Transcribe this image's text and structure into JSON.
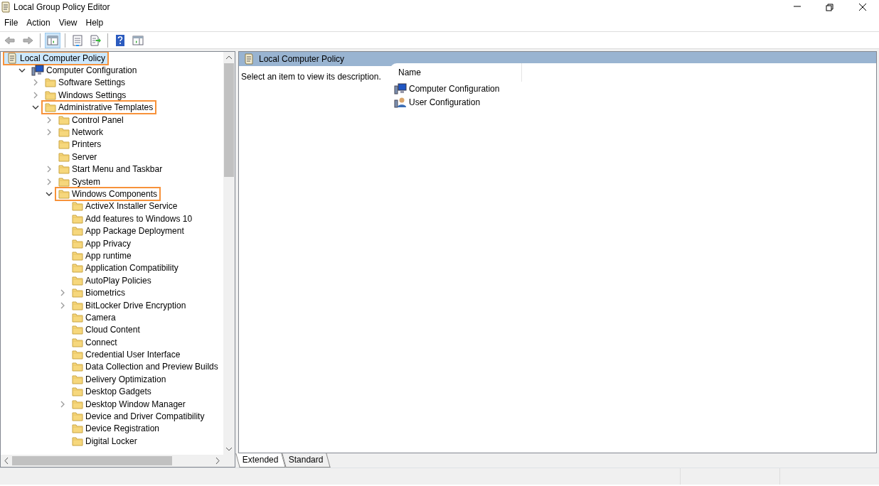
{
  "window": {
    "title": "Local Group Policy Editor"
  },
  "menu": [
    "File",
    "Action",
    "View",
    "Help"
  ],
  "toolbar": [
    {
      "kind": "back",
      "disabled": true
    },
    {
      "kind": "forward",
      "disabled": true
    },
    {
      "kind": "separator"
    },
    {
      "kind": "tree-toggle",
      "selected": true
    },
    {
      "kind": "separator"
    },
    {
      "kind": "properties"
    },
    {
      "kind": "export"
    },
    {
      "kind": "separator"
    },
    {
      "kind": "help"
    },
    {
      "kind": "action-pane"
    }
  ],
  "tree": [
    {
      "label": "Local Computer Policy",
      "kind": "policy",
      "expandable": false,
      "selected": true,
      "highlighted": true,
      "children": [
        {
          "label": "Computer Configuration",
          "kind": "computer",
          "expandable": true,
          "expanded": true,
          "selected": false,
          "highlighted": false,
          "children": [
            {
              "label": "Software Settings",
              "kind": "folder",
              "expandable": true,
              "expanded": false,
              "selected": false,
              "highlighted": false
            },
            {
              "label": "Windows Settings",
              "kind": "folder",
              "expandable": true,
              "expanded": false,
              "selected": false,
              "highlighted": false
            },
            {
              "label": "Administrative Templates",
              "kind": "folder",
              "expandable": true,
              "expanded": true,
              "selected": false,
              "highlighted": true,
              "children": [
                {
                  "label": "Control Panel",
                  "kind": "folder",
                  "expandable": true,
                  "expanded": false,
                  "selected": false,
                  "highlighted": false
                },
                {
                  "label": "Network",
                  "kind": "folder",
                  "expandable": true,
                  "expanded": false,
                  "selected": false,
                  "highlighted": false
                },
                {
                  "label": "Printers",
                  "kind": "folder",
                  "expandable": false,
                  "selected": false,
                  "highlighted": false
                },
                {
                  "label": "Server",
                  "kind": "folder",
                  "expandable": false,
                  "selected": false,
                  "highlighted": false
                },
                {
                  "label": "Start Menu and Taskbar",
                  "kind": "folder",
                  "expandable": true,
                  "expanded": false,
                  "selected": false,
                  "highlighted": false
                },
                {
                  "label": "System",
                  "kind": "folder",
                  "expandable": true,
                  "expanded": false,
                  "selected": false,
                  "highlighted": false
                },
                {
                  "label": "Windows Components",
                  "kind": "folder",
                  "expandable": true,
                  "expanded": true,
                  "selected": false,
                  "highlighted": true,
                  "children": [
                    {
                      "label": "ActiveX Installer Service",
                      "kind": "folder",
                      "expandable": false,
                      "selected": false,
                      "highlighted": false
                    },
                    {
                      "label": "Add features to Windows 10",
                      "kind": "folder",
                      "expandable": false,
                      "selected": false,
                      "highlighted": false
                    },
                    {
                      "label": "App Package Deployment",
                      "kind": "folder",
                      "expandable": false,
                      "selected": false,
                      "highlighted": false
                    },
                    {
                      "label": "App Privacy",
                      "kind": "folder",
                      "expandable": false,
                      "selected": false,
                      "highlighted": false
                    },
                    {
                      "label": "App runtime",
                      "kind": "folder",
                      "expandable": false,
                      "selected": false,
                      "highlighted": false
                    },
                    {
                      "label": "Application Compatibility",
                      "kind": "folder",
                      "expandable": false,
                      "selected": false,
                      "highlighted": false
                    },
                    {
                      "label": "AutoPlay Policies",
                      "kind": "folder",
                      "expandable": false,
                      "selected": false,
                      "highlighted": false
                    },
                    {
                      "label": "Biometrics",
                      "kind": "folder",
                      "expandable": true,
                      "expanded": false,
                      "selected": false,
                      "highlighted": false
                    },
                    {
                      "label": "BitLocker Drive Encryption",
                      "kind": "folder",
                      "expandable": true,
                      "expanded": false,
                      "selected": false,
                      "highlighted": false
                    },
                    {
                      "label": "Camera",
                      "kind": "folder",
                      "expandable": false,
                      "selected": false,
                      "highlighted": false
                    },
                    {
                      "label": "Cloud Content",
                      "kind": "folder",
                      "expandable": false,
                      "selected": false,
                      "highlighted": false
                    },
                    {
                      "label": "Connect",
                      "kind": "folder",
                      "expandable": false,
                      "selected": false,
                      "highlighted": false
                    },
                    {
                      "label": "Credential User Interface",
                      "kind": "folder",
                      "expandable": false,
                      "selected": false,
                      "highlighted": false
                    },
                    {
                      "label": "Data Collection and Preview Builds",
                      "kind": "folder",
                      "expandable": false,
                      "selected": false,
                      "highlighted": false
                    },
                    {
                      "label": "Delivery Optimization",
                      "kind": "folder",
                      "expandable": false,
                      "selected": false,
                      "highlighted": false
                    },
                    {
                      "label": "Desktop Gadgets",
                      "kind": "folder",
                      "expandable": false,
                      "selected": false,
                      "highlighted": false
                    },
                    {
                      "label": "Desktop Window Manager",
                      "kind": "folder",
                      "expandable": true,
                      "expanded": false,
                      "selected": false,
                      "highlighted": false
                    },
                    {
                      "label": "Device and Driver Compatibility",
                      "kind": "folder",
                      "expandable": false,
                      "selected": false,
                      "highlighted": false
                    },
                    {
                      "label": "Device Registration",
                      "kind": "folder",
                      "expandable": false,
                      "selected": false,
                      "highlighted": false
                    },
                    {
                      "label": "Digital Locker",
                      "kind": "folder",
                      "expandable": false,
                      "selected": false,
                      "highlighted": false
                    }
                  ]
                }
              ]
            }
          ]
        }
      ]
    }
  ],
  "details": {
    "header": "Local Computer Policy",
    "description": "Select an item to view its description.",
    "columns": [
      "Name"
    ],
    "rows": [
      {
        "name": "Computer Configuration",
        "kind": "computer"
      },
      {
        "name": "User Configuration",
        "kind": "user"
      }
    ]
  },
  "view_tabs": [
    {
      "label": "Extended",
      "selected": true
    },
    {
      "label": "Standard",
      "selected": false
    }
  ]
}
